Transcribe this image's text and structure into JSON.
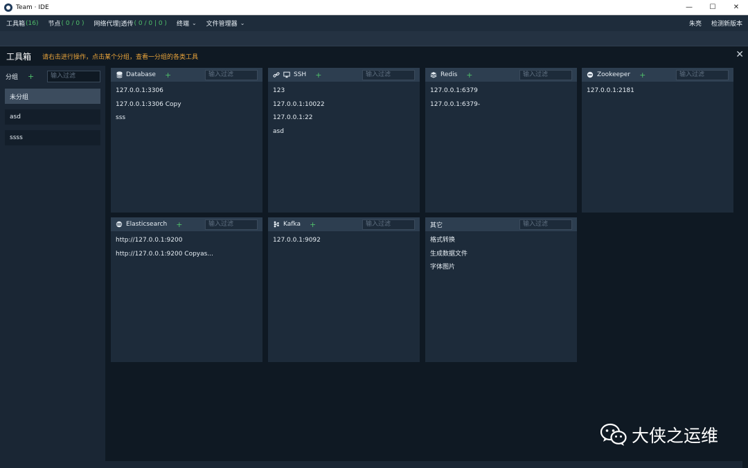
{
  "window": {
    "title": "Team · IDE",
    "minimize": "—",
    "maximize": "☐",
    "close": "✕"
  },
  "menu": {
    "toolbox": {
      "label": "工具箱",
      "count": "(16)"
    },
    "nodes": {
      "label": "节点",
      "count": "( 0 / 0 )"
    },
    "proxy": {
      "label": "网络代理|透传",
      "count": "( 0 / 0 | 0 )"
    },
    "terminal": {
      "label": "终端"
    },
    "file_manager": {
      "label": "文件管理器"
    },
    "user": "朱亮",
    "check_update": "检测新版本"
  },
  "toolbox": {
    "title": "工具箱",
    "hint": "请右击进行操作，点击某个分组，查看一分组的各类工具",
    "close": "✕"
  },
  "sidebar": {
    "label": "分组",
    "add": "+",
    "filter_placeholder": "输入过滤",
    "groups": [
      "未分组",
      "asd",
      "ssss"
    ]
  },
  "panels": {
    "database": {
      "title": "Database",
      "add": "+",
      "placeholder": "输入过滤",
      "items": [
        "127.0.0.1:3306",
        "127.0.0.1:3306 Copy",
        "sss"
      ]
    },
    "ssh": {
      "title": "SSH",
      "add": "+",
      "placeholder": "输入过滤",
      "items": [
        "123",
        "127.0.0.1:10022",
        "127.0.0.1:22",
        "asd"
      ]
    },
    "redis": {
      "title": "Redis",
      "add": "+",
      "placeholder": "输入过滤",
      "items": [
        "127.0.0.1:6379",
        "127.0.0.1:6379-"
      ]
    },
    "zookeeper": {
      "title": "Zookeeper",
      "add": "+",
      "placeholder": "输入过滤",
      "items": [
        "127.0.0.1:2181"
      ]
    },
    "elasticsearch": {
      "title": "Elasticsearch",
      "add": "+",
      "placeholder": "输入过滤",
      "items": [
        "http://127.0.0.1:9200",
        "http://127.0.0.1:9200 Copyas..."
      ]
    },
    "kafka": {
      "title": "Kafka",
      "add": "+",
      "placeholder": "输入过滤",
      "items": [
        "127.0.0.1:9092"
      ]
    },
    "other": {
      "title": "其它",
      "placeholder": "输入过滤",
      "items": [
        "格式转换",
        "生成数据文件",
        "字体图片"
      ]
    }
  },
  "watermark": {
    "text": "大侠之运维"
  },
  "colors": {
    "accent_green": "#4fbf6a",
    "hint_orange": "#e8a33a",
    "panel_bg": "#1d2b3a",
    "panel_head": "#2d3e50"
  }
}
